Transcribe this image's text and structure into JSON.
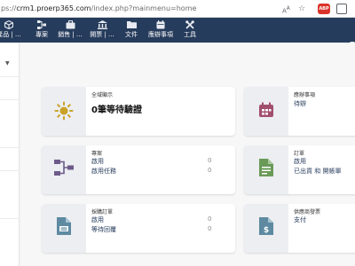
{
  "browser": {
    "url_prefix": "ps://",
    "url_host": "crm1.proerp365.com",
    "url_path": "/index.php?mainmenu=home",
    "abp_label": "ABP"
  },
  "topnav": {
    "items": [
      {
        "label": "產品 | ...",
        "icon": "cube-icon"
      },
      {
        "label": "專案",
        "icon": "sitemap-icon"
      },
      {
        "label": "銷售 | ...",
        "icon": "briefcase-icon"
      },
      {
        "label": "開票 | ...",
        "icon": "bank-icon"
      },
      {
        "label": "文件",
        "icon": "folder-icon"
      },
      {
        "label": "應辦事項",
        "icon": "calendar-icon"
      },
      {
        "label": "工具",
        "icon": "tools-icon"
      }
    ]
  },
  "cards": {
    "global": {
      "title": "全域顯示",
      "value": "0筆等待驗證"
    },
    "agenda": {
      "title": "應辦事項",
      "link": "待辦"
    },
    "projects": {
      "title": "專案",
      "rows": [
        {
          "label": "啟用",
          "count": "0"
        },
        {
          "label": "啟用任務",
          "count": "0"
        }
      ]
    },
    "orders": {
      "title": "訂單",
      "rows": [
        {
          "label": "啟用"
        },
        {
          "label": "已出貨 和 開帳單"
        }
      ]
    },
    "purchase": {
      "title": "採購訂單",
      "rows": [
        {
          "label": "啟用",
          "count": "0"
        },
        {
          "label": "等待回覆",
          "count": "0"
        }
      ]
    },
    "supplier_invoices": {
      "title": "供應商發票",
      "rows": [
        {
          "label": "支付"
        }
      ]
    }
  },
  "colors": {
    "nav_background": "#263c5c",
    "link": "#263c5c",
    "icon_gold": "#c9a227",
    "icon_agenda": "#a24f6e",
    "icon_projects": "#6d5a8a",
    "icon_orders": "#6a9a58",
    "icon_purchase": "#5d8aa1",
    "icon_invoice": "#5d8aa1"
  }
}
